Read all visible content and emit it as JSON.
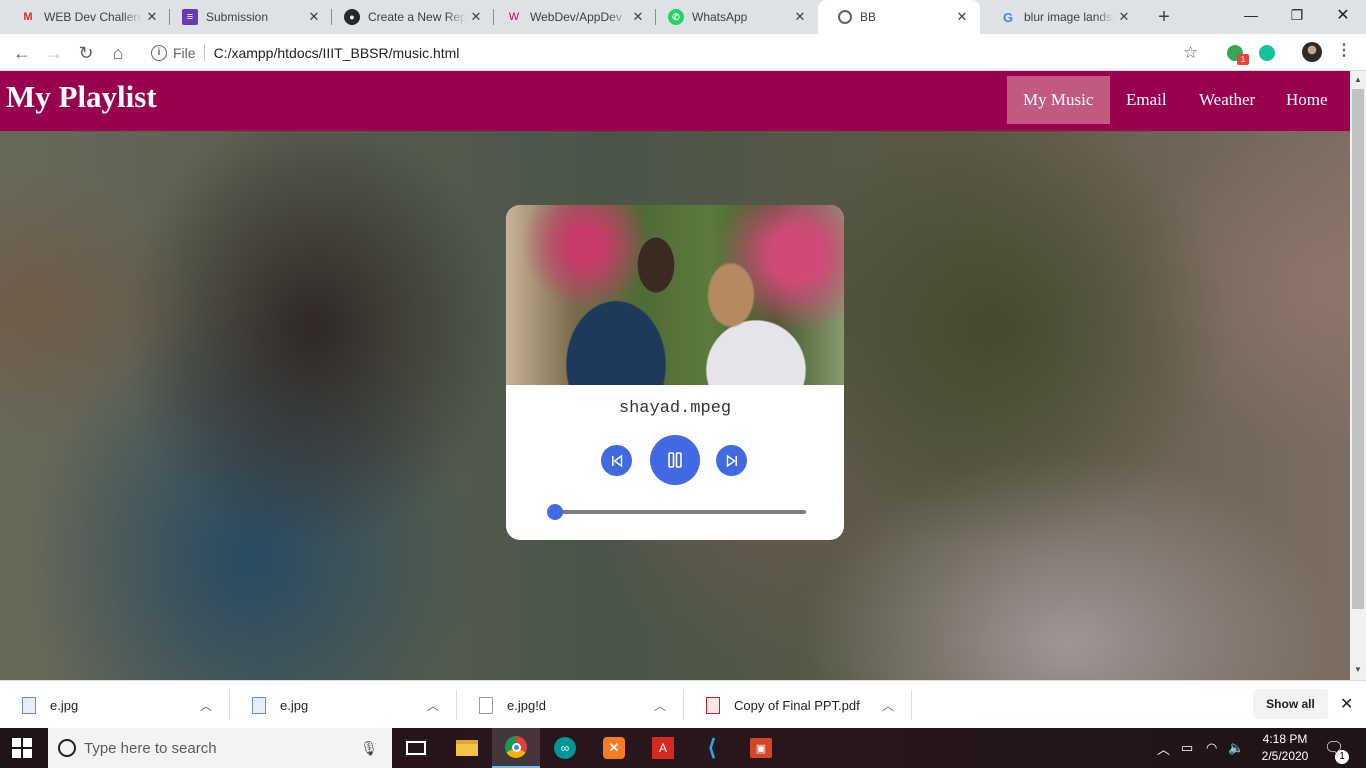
{
  "browser": {
    "tabs": [
      {
        "title": "WEB Dev Challenge",
        "icon": "gmail-icon"
      },
      {
        "title": "Submission",
        "icon": "forms-icon"
      },
      {
        "title": "Create a New Repository",
        "icon": "github-icon"
      },
      {
        "title": "WebDev/AppDev",
        "icon": "w-icon"
      },
      {
        "title": "WhatsApp",
        "icon": "whatsapp-icon"
      },
      {
        "title": "BB",
        "icon": "globe-icon"
      },
      {
        "title": "blur image landscape",
        "icon": "google-icon"
      }
    ],
    "address": {
      "scheme_label": "File",
      "url": "C:/xampp/htdocs/IIIT_BBSR/music.html"
    },
    "extension_badge": "1"
  },
  "page": {
    "brand": "My Playlist",
    "nav": [
      {
        "label": "My Music",
        "active": true
      },
      {
        "label": "Email",
        "active": false
      },
      {
        "label": "Weather",
        "active": false
      },
      {
        "label": "Home",
        "active": false
      }
    ],
    "player": {
      "track_name": "shayad.mpeg",
      "state": "playing",
      "progress": 0.0
    },
    "colors": {
      "navbar": "#99004d",
      "nav_active": "#c05a80",
      "accent": "#4169e1"
    }
  },
  "downloads": {
    "items": [
      {
        "name": "e.jpg",
        "icon": "image-file-icon"
      },
      {
        "name": "e.jpg",
        "icon": "image-file-icon"
      },
      {
        "name": "e.jpg!d",
        "icon": "blank-file-icon"
      },
      {
        "name": "Copy of Final PPT.pdf",
        "icon": "pdf-file-icon"
      }
    ],
    "show_all": "Show all"
  },
  "taskbar": {
    "search_placeholder": "Type here to search",
    "time": "4:18 PM",
    "date": "2/5/2020",
    "notification_count": "1"
  }
}
